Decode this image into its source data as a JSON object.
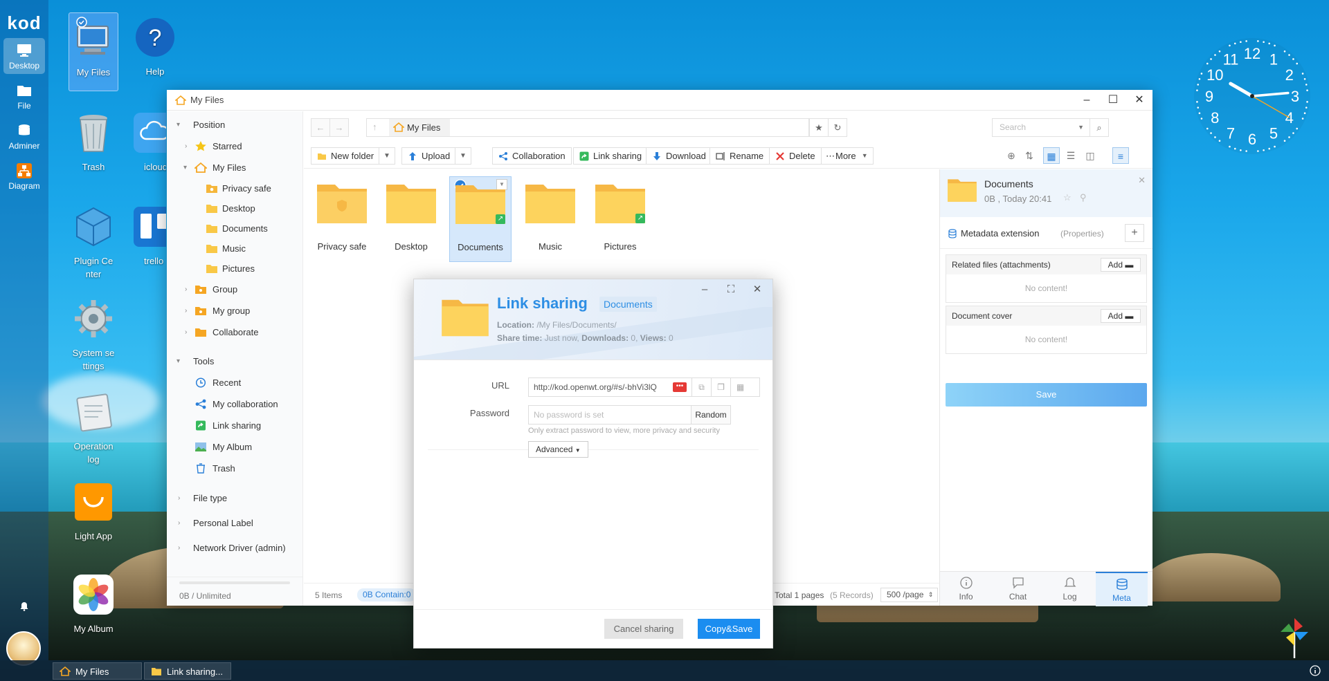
{
  "dock": {
    "logo": "kod",
    "items": [
      {
        "label": "Desktop",
        "icon": "monitor-icon"
      },
      {
        "label": "File",
        "icon": "folder-icon"
      },
      {
        "label": "Adminer",
        "icon": "database-icon"
      },
      {
        "label": "Diagram",
        "icon": "diagram-icon"
      }
    ]
  },
  "desktop_icons": [
    {
      "label": "My Files",
      "icon": "computer-icon"
    },
    {
      "label": "Help",
      "icon": "help-icon"
    },
    {
      "label": "Trash",
      "icon": "trash-icon"
    },
    {
      "label": "icloud",
      "icon": "cloud-icon"
    },
    {
      "label": "Plugin Ce nter",
      "icon": "plugin-icon"
    },
    {
      "label": "trello",
      "icon": "trello-icon"
    },
    {
      "label": "System se ttings",
      "icon": "gear-icon"
    },
    {
      "label": "Operation log",
      "icon": "calendar-icon"
    },
    {
      "label": "Light App",
      "icon": "shopping-bag-icon"
    },
    {
      "label": "My Album",
      "icon": "photos-icon"
    }
  ],
  "clock": {
    "numbers": [
      "12",
      "1",
      "2",
      "3",
      "4",
      "5",
      "6",
      "7",
      "8",
      "9",
      "10",
      "11"
    ]
  },
  "window": {
    "title": "My Files",
    "tree": {
      "position": "Position",
      "starred": "Starred",
      "my_files": "My Files",
      "children": [
        "Privacy safe",
        "Desktop",
        "Documents",
        "Music",
        "Pictures"
      ],
      "group": "Group",
      "my_group": "My group",
      "collaborate": "Collaborate",
      "tools": "Tools",
      "tool_items": [
        "Recent",
        "My collaboration",
        "Link sharing",
        "My Album",
        "Trash"
      ],
      "file_type": "File type",
      "personal_label": "Personal Label",
      "network_driver": "Network Driver (admin)",
      "quota": "0B / Unlimited"
    },
    "breadcrumb": "My Files",
    "search_placeholder": "Search",
    "toolbar": {
      "new_folder": "New folder",
      "upload": "Upload",
      "collaboration": "Collaboration",
      "link_sharing": "Link sharing",
      "download": "Download",
      "rename": "Rename",
      "delete": "Delete",
      "more": "More"
    },
    "files": [
      {
        "name": "Privacy safe",
        "shared": false,
        "selected": false
      },
      {
        "name": "Desktop",
        "shared": false,
        "selected": false
      },
      {
        "name": "Documents",
        "shared": true,
        "selected": true
      },
      {
        "name": "Music",
        "shared": false,
        "selected": false
      },
      {
        "name": "Pictures",
        "shared": true,
        "selected": false
      }
    ],
    "status": {
      "items": "5 Items",
      "contain": "0B Contain:0",
      "pages": "Total 1 pages",
      "records": "(5 Records)",
      "per_page": "500 /page"
    },
    "props": {
      "name": "Documents",
      "meta": "0B , Today 20:41",
      "metadata": "Metadata extension",
      "metadata_sub": "(Properties)",
      "related": "Related files (attachments)",
      "cover": "Document cover",
      "add": "Add",
      "no_content": "No content!",
      "save": "Save",
      "tabs": [
        "Info",
        "Chat",
        "Log",
        "Meta"
      ]
    }
  },
  "dialog": {
    "title": "Link sharing",
    "tag": "Documents",
    "location_label": "Location:",
    "location": "/My Files/Documents/",
    "share_time_label": "Share time:",
    "share_time": "Just now",
    "downloads_label": "Downloads:",
    "downloads": "0",
    "views_label": "Views:",
    "views": "0",
    "url_label": "URL",
    "url": "http://kod.openwt.org/#s/-bhVi3lQ",
    "password_label": "Password",
    "password_placeholder": "No password is set",
    "random": "Random",
    "hint": "Only extract password to view, more privacy and security",
    "advanced": "Advanced",
    "cancel": "Cancel sharing",
    "ok": "Copy&Save"
  },
  "taskbar": {
    "tasks": [
      "My Files",
      "Link sharing..."
    ]
  },
  "colors": {
    "accent": "#1b8df0",
    "folder": "#fcd15a",
    "dock_bg": "#0a468c"
  }
}
